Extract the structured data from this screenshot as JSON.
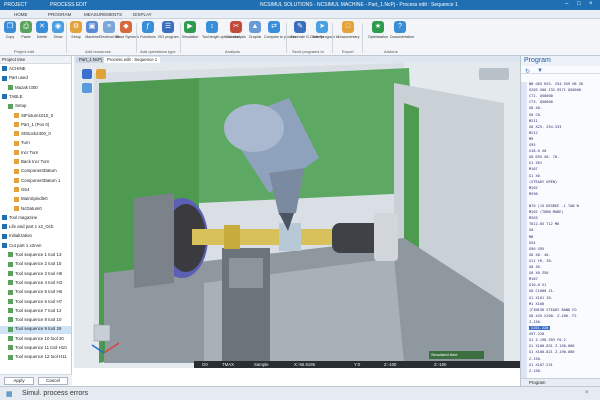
{
  "titlebar": {
    "tab_project": "PROJECT",
    "tab_process_edit": "PROCESS EDIT",
    "title": "NCSIMUL SOLUTIONS - NCSIMUL MACHINE - Part_1.NcPj - Process edit : Sequence 1"
  },
  "menubar": {
    "items": [
      "HOME",
      "PROGRAM",
      "MEASUREMENTS",
      "DISPLAY"
    ]
  },
  "ribbon": {
    "buttons": [
      {
        "label": "Copy",
        "icon": "copy-icon"
      },
      {
        "label": "Paste",
        "icon": "paste-icon"
      },
      {
        "label": "Delete",
        "icon": "delete-icon"
      },
      {
        "label": "Show",
        "icon": "show-icon"
      },
      {
        "label": "Setup",
        "icon": "setup-icon"
      },
      {
        "label": "Machine",
        "icon": "machine-icon"
      },
      {
        "label": "Electrical list",
        "icon": "list-icon"
      },
      {
        "label": "Base Symbols",
        "icon": "symbols-icon"
      },
      {
        "label": "Functions",
        "icon": "functions-icon"
      },
      {
        "label": "ISO program",
        "icon": "iso-icon"
      },
      {
        "label": "Simulation",
        "icon": "simulation-icon"
      },
      {
        "label": "Tool length optimization",
        "icon": "tool-length-icon"
      },
      {
        "label": "Cut analysis",
        "icon": "cut-analysis-icon"
      },
      {
        "label": "Graphic",
        "icon": "graphic-icon"
      },
      {
        "label": "Compare to process",
        "icon": "compare-icon"
      },
      {
        "label": "Generate G-Code file",
        "icon": "gcode-icon"
      },
      {
        "label": "Send program to",
        "icon": "send-icon"
      },
      {
        "label": "Documentary",
        "icon": "documentary-icon"
      },
      {
        "label": "Optimization",
        "icon": "optimization-icon"
      },
      {
        "label": "Documentation",
        "icon": "documentation-icon"
      }
    ],
    "groups": [
      "Project edit",
      "Add resources",
      "Add operations type",
      "Analysis",
      "Send programs to",
      "Export",
      "Addons"
    ]
  },
  "left_panel": {
    "header": "Project tree",
    "rows": [
      {
        "text": "ACHINE",
        "level": 0
      },
      {
        "text": "Part used",
        "level": 0
      },
      {
        "text": "Mazak I300",
        "level": 1
      },
      {
        "text": "TABLE",
        "level": 0
      },
      {
        "text": "Setup",
        "level": 1
      },
      {
        "text": "StFixture1010_0",
        "level": 2
      },
      {
        "text": "Part_1 (Pos 0)",
        "level": 2
      },
      {
        "text": "StStock2400_0",
        "level": 2
      },
      {
        "text": "Turn",
        "level": 2
      },
      {
        "text": "Incr Turn",
        "level": 2
      },
      {
        "text": "Back Incr Turn",
        "level": 2
      },
      {
        "text": "ComponentDatum",
        "level": 2
      },
      {
        "text": "ComponentDatum 1",
        "level": 2
      },
      {
        "text": "G54",
        "level": 2
      },
      {
        "text": "MainSpindle0",
        "level": 2
      },
      {
        "text": "NcDatum0",
        "level": 2
      },
      {
        "text": "Tool magazine",
        "level": 0
      },
      {
        "text": "Life and part 1 x2_Ocb",
        "level": 0
      },
      {
        "text": "Initialization",
        "level": 0
      },
      {
        "text": "Cut part 1 x2nnn",
        "level": 0
      },
      {
        "text": "Tool sequence 1 tool 13",
        "level": 1
      },
      {
        "text": "Tool sequence 2 tool 15",
        "level": 1
      },
      {
        "text": "Tool sequence 3 tool H5",
        "level": 1
      },
      {
        "text": "Tool sequence 4 tool H3",
        "level": 1
      },
      {
        "text": "Tool sequence 5 tool H6",
        "level": 1
      },
      {
        "text": "Tool sequence 6 tool H7",
        "level": 1
      },
      {
        "text": "Tool sequence 7 tool 12",
        "level": 1
      },
      {
        "text": "Tool sequence 8 tool 10",
        "level": 1
      },
      {
        "text": "Tool sequence 9 tool 26",
        "level": 1
      },
      {
        "text": "Tool sequence 10 tool 20",
        "level": 1
      },
      {
        "text": "Tool sequence 11 tool H10",
        "level": 1
      },
      {
        "text": "Tool sequence 12 tool H11",
        "level": 1
      }
    ],
    "apply_label": "Apply",
    "cancel_label": "Cancel"
  },
  "viewport": {
    "tabs": [
      "Part_1.NcPj",
      "Process edit : Sequence 1"
    ],
    "status_values": [
      "G0",
      "TMAX",
      "Sample",
      "X:-56.8186",
      "Y:0",
      "Z:-100",
      "Z:-150"
    ],
    "sim_label": "Simulated time"
  },
  "program": {
    "title": "Program",
    "lines": [
      "N8 G65 H25. 254.559 H8 Z0",
      "G203 G00 I32.9571 Q50000",
      "C72. Q50000",
      "C73. Q50000",
      "G0 X0.",
      "G0 C0.",
      "M211",
      "G0 X25. Z54.533",
      "M212",
      "M9",
      "G95",
      "G18.0 X0",
      "G0 D55 X0. 70.",
      "G1 Z61",
      "M107",
      "G1 X0",
      "(STEADY OPEN)",
      "M202",
      "M296",
      "",
      "N70 (15 DEGREE .1 TAN N",
      "M202 (TURN MODE)",
      "M203",
      "T012.05 T12 M6",
      "G0",
      "M8",
      "G54",
      "G90 G95",
      "G0 X0. 40.",
      "G11 Y0. Z0.",
      "G0 Z6.",
      "G0 X0 Z50",
      "M107",
      "G10.0 X1",
      "G0 C1000 Z1.",
      "G1 X101 Z0.",
      "M1 X100",
      "(FINISH STEADY BAND FO",
      "G0 X45 X100. Z-100. F2",
      "Z-150.",
      "X101.220",
      "X97.220",
      "G1 Z-198.393 F0.2",
      "G1 X100.831 Z-150.000",
      "G1 X100.821 Z-190.000",
      "Z-150.",
      "G1 X107.231",
      "Z-150."
    ],
    "highlight_index": 40,
    "footer_label": "Program"
  },
  "bottom": {
    "title": "Simul. process errors"
  },
  "colors": {
    "title_blue": "#1f6fb2",
    "machine_green": "#4e9a51",
    "highlight_blue": "#3d6fcf"
  }
}
